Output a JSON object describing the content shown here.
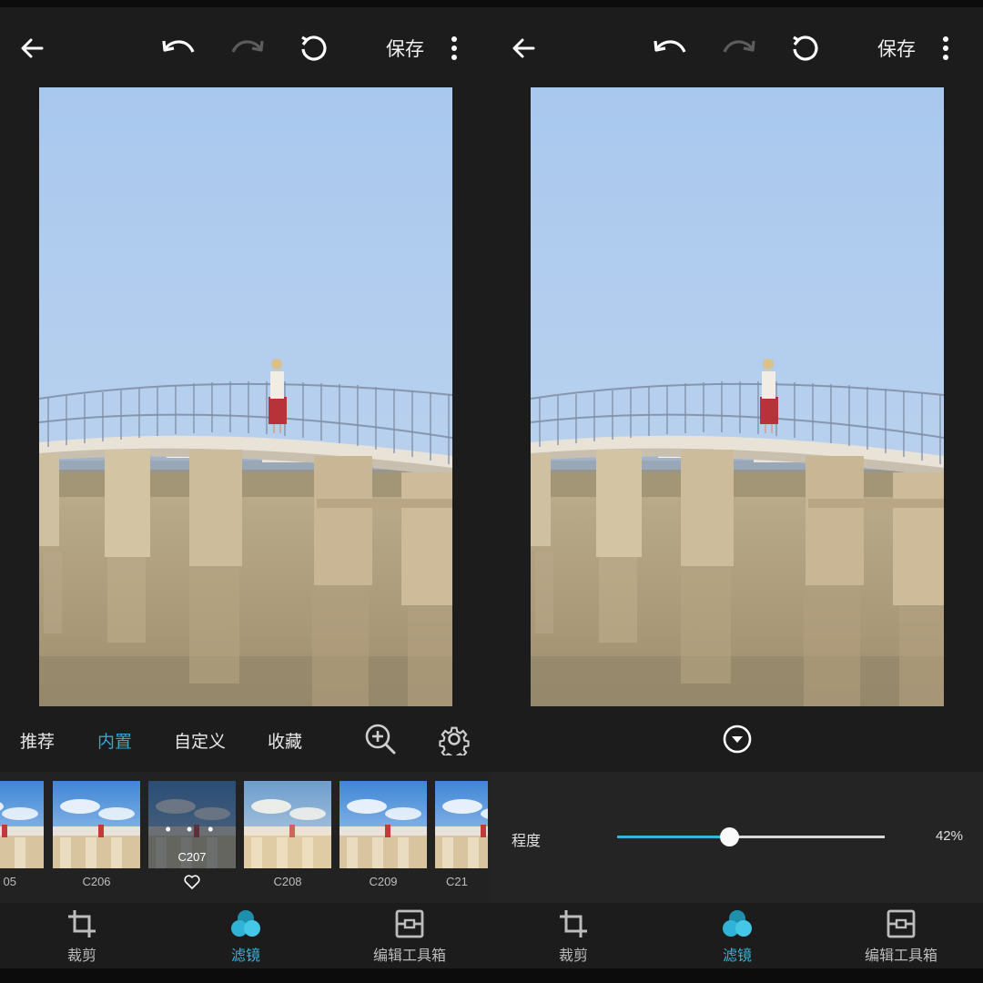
{
  "header": {
    "save_label": "保存",
    "icons": [
      "back-arrow-icon",
      "undo-icon",
      "redo-icon",
      "reset-icon",
      "more-vertical-icon"
    ]
  },
  "left": {
    "tabs": [
      {
        "label": "推荐",
        "active": false
      },
      {
        "label": "内置",
        "active": true
      },
      {
        "label": "自定义",
        "active": false
      },
      {
        "label": "收藏",
        "active": false
      }
    ],
    "toolbar_icons": [
      "zoom-in-icon",
      "gear-icon"
    ],
    "filters": [
      {
        "label": "05",
        "selected": false
      },
      {
        "label": "C206",
        "selected": false
      },
      {
        "label": "C207",
        "selected": true,
        "overlay": "• • •"
      },
      {
        "label": "C208",
        "selected": false
      },
      {
        "label": "C209",
        "selected": false
      },
      {
        "label": "C21",
        "selected": false
      }
    ]
  },
  "right": {
    "collapse_icon": "chevron-down-circle-icon",
    "adjust": {
      "label": "程度",
      "value_text": "42%",
      "value": 0.42
    }
  },
  "nav": {
    "items": [
      {
        "label": "裁剪",
        "icon": "crop-icon",
        "active": false
      },
      {
        "label": "滤镜",
        "icon": "filter-icon",
        "active": true
      },
      {
        "label": "编辑工具箱",
        "icon": "toolbox-icon",
        "active": false
      }
    ]
  },
  "colors": {
    "accent": "#34b6dc",
    "background": "#1c1c1c",
    "panel": "#242424"
  }
}
